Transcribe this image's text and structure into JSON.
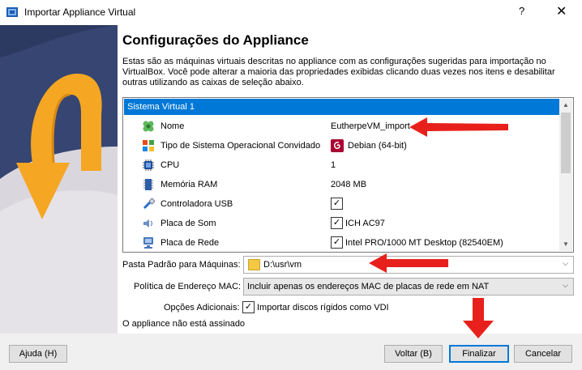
{
  "window": {
    "title": "Importar Appliance Virtual",
    "help_glyph": "?",
    "close_glyph": "✕"
  },
  "page": {
    "heading": "Configurações do Appliance",
    "description": "Estas são as máquinas virtuais descritas no appliance com as configurações sugeridas para importação no VirtualBox. Você pode alterar a maioria das propriedades exibidas clicando duas vezes nos itens e desabilitar outras utilizando as caixas de seleção abaixo."
  },
  "tree": {
    "header": "Sistema Virtual 1",
    "rows": [
      {
        "label": "Nome",
        "value": "EutherpeVM_import",
        "icon": "name-icon"
      },
      {
        "label": "Tipo de Sistema Operacional Convidado",
        "value": "Debian (64-bit)",
        "icon": "os-type-icon"
      },
      {
        "label": "CPU",
        "value": "1",
        "icon": "cpu-icon"
      },
      {
        "label": "Memória RAM",
        "value": "2048 MB",
        "icon": "ram-icon"
      },
      {
        "label": "Controladora USB",
        "value": "",
        "checked": true,
        "icon": "usb-icon"
      },
      {
        "label": "Placa de Som",
        "value": "ICH AC97",
        "checked": true,
        "icon": "sound-icon"
      },
      {
        "label": "Placa de Rede",
        "value": "Intel PRO/1000 MT Desktop (82540EM)",
        "checked": true,
        "icon": "network-icon"
      }
    ]
  },
  "form": {
    "folder_label": "Pasta Padrão para Máquinas:",
    "folder_value": "D:\\usr\\vm",
    "mac_label": "Política de Endereço MAC:",
    "mac_value": "Incluir apenas os endereços MAC de placas de rede em NAT",
    "options_label": "Opções Adicionais:",
    "import_disks_label": "Importar discos rígidos como VDI",
    "import_disks_checked": true,
    "signature_status": "O appliance não está assinado"
  },
  "buttons": {
    "help": "Ajuda (H)",
    "back": "Voltar (B)",
    "finish": "Finalizar",
    "cancel": "Cancelar"
  },
  "colors": {
    "selection": "#0078d7",
    "annotation_arrow": "#e8201c"
  }
}
